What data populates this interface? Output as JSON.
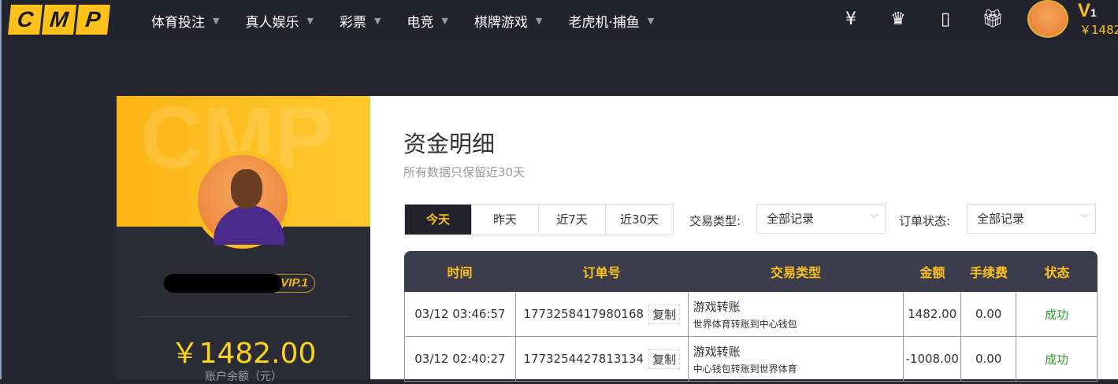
{
  "header": {
    "logo": [
      "C",
      "M",
      "P"
    ],
    "menu": [
      {
        "label": "体育投注"
      },
      {
        "label": "真人娱乐"
      },
      {
        "label": "彩票"
      },
      {
        "label": "电竞"
      },
      {
        "label": "棋牌游戏"
      },
      {
        "label": "老虎机·捕鱼"
      }
    ],
    "icons": [
      "yen-ticket-icon",
      "crown-icon",
      "tablet-icon",
      "gift-icon"
    ],
    "vip_level": "V",
    "vip_num": "1",
    "balance": "￥1482."
  },
  "profile": {
    "watermark": "CMP",
    "vip_badge": "VIP.1",
    "balance": "￥1482.00",
    "balance_label": "账户余额（元）"
  },
  "main": {
    "title": "资金明细",
    "subtitle": "所有数据只保留近30天",
    "tabs": [
      {
        "label": "今天",
        "active": true
      },
      {
        "label": "昨天"
      },
      {
        "label": "近7天"
      },
      {
        "label": "近30天"
      }
    ],
    "filter_type_label": "交易类型:",
    "filter_type_value": "全部记录",
    "filter_status_label": "订单状态:",
    "filter_status_value": "全部记录",
    "columns": [
      "时间",
      "订单号",
      "交易类型",
      "金额",
      "手续费",
      "状态"
    ],
    "copy_label": "复制",
    "rows": [
      {
        "time": "03/12 03:46:57",
        "order": "1773258417980168",
        "type": "游戏转账",
        "detail": "世界体育转账到中心钱包",
        "amount": "1482.00",
        "fee": "0.00",
        "status": "成功"
      },
      {
        "time": "03/12 02:40:27",
        "order": "1773254427813134",
        "type": "游戏转账",
        "detail": "中心钱包转账到世界体育",
        "amount": "-1008.00",
        "fee": "0.00",
        "status": "成功"
      }
    ]
  },
  "colors": {
    "accent": "#fcc21b",
    "success": "#2ca02c",
    "nav_bg": "#23232d"
  }
}
